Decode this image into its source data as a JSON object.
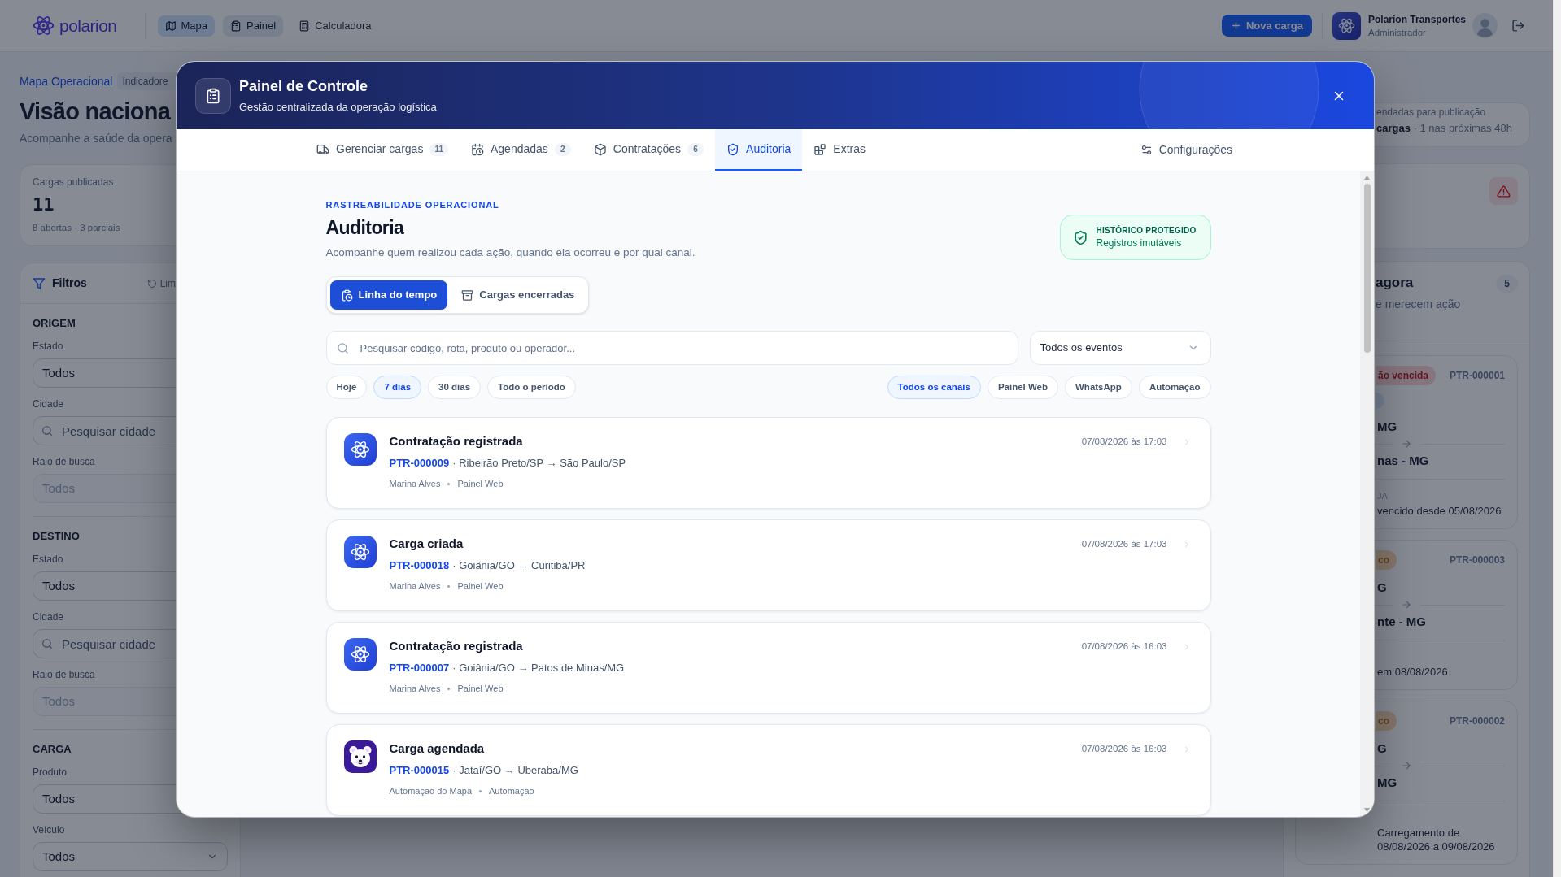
{
  "top_bar": {
    "logo_text": "polarion",
    "nav": [
      {
        "label": "Mapa",
        "selected": true,
        "open": false
      },
      {
        "label": "Painel",
        "selected": false,
        "open": true
      },
      {
        "label": "Calculadora",
        "selected": false,
        "open": false
      }
    ],
    "new_load_button": "Nova carga",
    "account": {
      "company": "Polarion Transportes",
      "role": "Administrador"
    }
  },
  "page": {
    "breadcrumb": "Mapa Operacional",
    "breadcrumb_tag": "Indicadore",
    "title": "Visão naciona",
    "subtitle": "Acompanhe a saúde da opera",
    "stat_card": {
      "label": "Cargas publicadas",
      "value": "11",
      "detail": "8 abertas · 3 parciais"
    },
    "filters": {
      "title": "Filtros",
      "reset": "Lim",
      "sections": [
        {
          "heading": "ORIGEM",
          "fields": [
            {
              "kind": "select",
              "label": "Estado",
              "value": "Todos",
              "disabled": false
            },
            {
              "kind": "search",
              "label": "Cidade",
              "placeholder": "Pesquisar cidade",
              "disabled": false
            },
            {
              "kind": "select",
              "label": "Raio de busca",
              "value": "Todos",
              "disabled": true
            }
          ]
        },
        {
          "heading": "DESTINO",
          "fields": [
            {
              "kind": "select",
              "label": "Estado",
              "value": "Todos",
              "disabled": false
            },
            {
              "kind": "search",
              "label": "Cidade",
              "placeholder": "Pesquisar cidade",
              "disabled": false
            },
            {
              "kind": "select",
              "label": "Raio de busca",
              "value": "Todos",
              "disabled": true
            }
          ]
        },
        {
          "heading": "CARGA",
          "fields": [
            {
              "kind": "select",
              "label": "Produto",
              "value": "Todos",
              "disabled": false
            },
            {
              "kind": "select",
              "label": "Veículo",
              "value": "Todos",
              "disabled": false
            }
          ]
        }
      ]
    }
  },
  "side_panel": {
    "schedule_card": {
      "caption": "endadas para publicação",
      "summary": "**cargas** · 1 nas próximas 48h"
    },
    "priority_card": {
      "title": "agora",
      "count": "5",
      "subtitle": "e merecem ação",
      "loads": [
        {
          "status": "ão vencida",
          "color": "#86757f",
          "tagged": true,
          "code": "PTR-000001",
          "origin": "MG",
          "destination": "nas - MG",
          "label": "JA",
          "note": "vencido desde 05/08/2026"
        },
        {
          "status": "co",
          "color": "#86776c",
          "tagged": false,
          "code": "PTR-000003",
          "origin": "G",
          "destination": "nte - MG",
          "note": "em 08/08/2026"
        },
        {
          "status": "co",
          "color": "#86776c",
          "tagged": false,
          "code": "PTR-000002",
          "origin": "G",
          "destination": "MG",
          "note": "Carregamento de 08/08/2026 a 09/08/2026"
        }
      ]
    }
  },
  "modal": {
    "title": "Painel de Controle",
    "subtitle": "Gestão centralizada da operação logística",
    "tabs": [
      {
        "label": "Gerenciar cargas",
        "count": "11",
        "selected": false
      },
      {
        "label": "Agendadas",
        "count": "2",
        "selected": false
      },
      {
        "label": "Contratações",
        "count": "6",
        "selected": false
      },
      {
        "label": "Auditoria",
        "selected": true
      },
      {
        "label": "Extras",
        "selected": false
      }
    ],
    "settings": "Configurações",
    "kicker": "RASTREABILIDADE OPERACIONAL",
    "heading": "Auditoria",
    "description": "Acompanhe quem realizou cada ação, quando ela ocorreu e por qual canal.",
    "protected_badge": {
      "title": "HISTÓRICO PROTEGIDO",
      "text": "Registros imutáveis"
    },
    "views": [
      {
        "label": "Linha do tempo",
        "selected": true
      },
      {
        "label": "Cargas encerradas",
        "selected": false
      }
    ],
    "search": {
      "placeholder": "Pesquisar código, rota, produto ou operador..."
    },
    "event_filter": {
      "value": "Todos os eventos"
    },
    "periods": [
      {
        "label": "Hoje",
        "selected": false
      },
      {
        "label": "7 dias",
        "selected": true
      },
      {
        "label": "30 dias",
        "selected": false
      },
      {
        "label": "Todo o período",
        "selected": false
      }
    ],
    "channels": [
      {
        "label": "Todos os canais",
        "selected": true
      },
      {
        "label": "Painel Web",
        "selected": false
      },
      {
        "label": "WhatsApp",
        "selected": false
      },
      {
        "label": "Automação",
        "selected": false
      }
    ],
    "events": [
      {
        "kind": "operator",
        "title": "Contratação registrada",
        "code": "PTR-000009",
        "route": "· Ribeirão Preto/SP → São Paulo/SP",
        "actor": "Marina Alves",
        "channel": "Painel Web",
        "time": "07/08/2026 às 17:03"
      },
      {
        "kind": "operator",
        "title": "Carga criada",
        "code": "PTR-000018",
        "route": "· Goiânia/GO → Curitiba/PR",
        "actor": "Marina Alves",
        "channel": "Painel Web",
        "time": "07/08/2026 às 17:03"
      },
      {
        "kind": "operator",
        "title": "Contratação registrada",
        "code": "PTR-000007",
        "route": "· Goiânia/GO → Patos de Minas/MG",
        "actor": "Marina Alves",
        "channel": "Painel Web",
        "time": "07/08/2026 às 16:03"
      },
      {
        "kind": "automation",
        "title": "Carga agendada",
        "code": "PTR-000015",
        "route": "· Jataí/GO → Uberaba/MG",
        "actor": "Automação do Mapa",
        "channel": "Automação",
        "time": "07/08/2026 às 16:03"
      }
    ]
  }
}
